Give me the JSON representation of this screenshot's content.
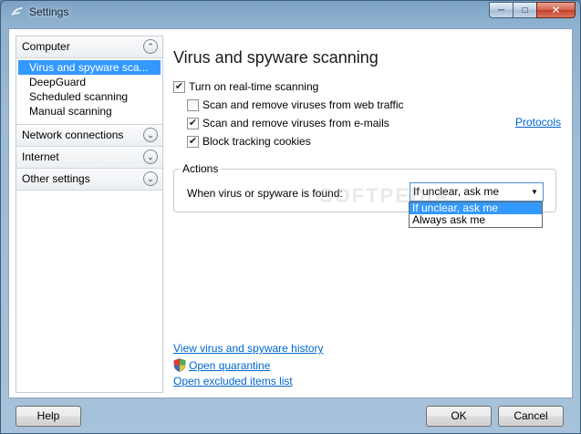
{
  "window": {
    "title": "Settings",
    "app_icon": "fsecure-f-icon"
  },
  "titlebar_buttons": {
    "minimize": "minimize-icon",
    "maximize": "maximize-icon",
    "close": "close-icon"
  },
  "sidebar": {
    "categories": [
      {
        "label": "Computer",
        "expanded": true,
        "items": [
          {
            "label": "Virus and spyware sca...",
            "selected": true
          },
          {
            "label": "DeepGuard"
          },
          {
            "label": "Scheduled scanning"
          },
          {
            "label": "Manual scanning"
          }
        ]
      },
      {
        "label": "Network connections",
        "expanded": false
      },
      {
        "label": "Internet",
        "expanded": false
      },
      {
        "label": "Other settings",
        "expanded": false
      }
    ]
  },
  "main": {
    "title": "Virus and spyware scanning",
    "realtime": {
      "label": "Turn on real-time scanning",
      "checked": true
    },
    "web_traffic": {
      "label": "Scan and remove viruses from web traffic",
      "checked": false
    },
    "emails": {
      "label": "Scan and remove viruses from e-mails",
      "checked": true
    },
    "cookies": {
      "label": "Block tracking cookies",
      "checked": true
    },
    "protocols_link": "Protocols",
    "actions": {
      "group_title": "Actions",
      "label": "When virus or spyware is found:",
      "selected": "If unclear, ask me",
      "options": [
        "If unclear, ask me",
        "Always ask me"
      ]
    },
    "watermark": "SOFTPEDIA",
    "links": {
      "history": "View virus and spyware history",
      "quarantine": "Open quarantine",
      "excluded": "Open excluded items list"
    }
  },
  "buttons": {
    "help": "Help",
    "ok": "OK",
    "cancel": "Cancel"
  }
}
